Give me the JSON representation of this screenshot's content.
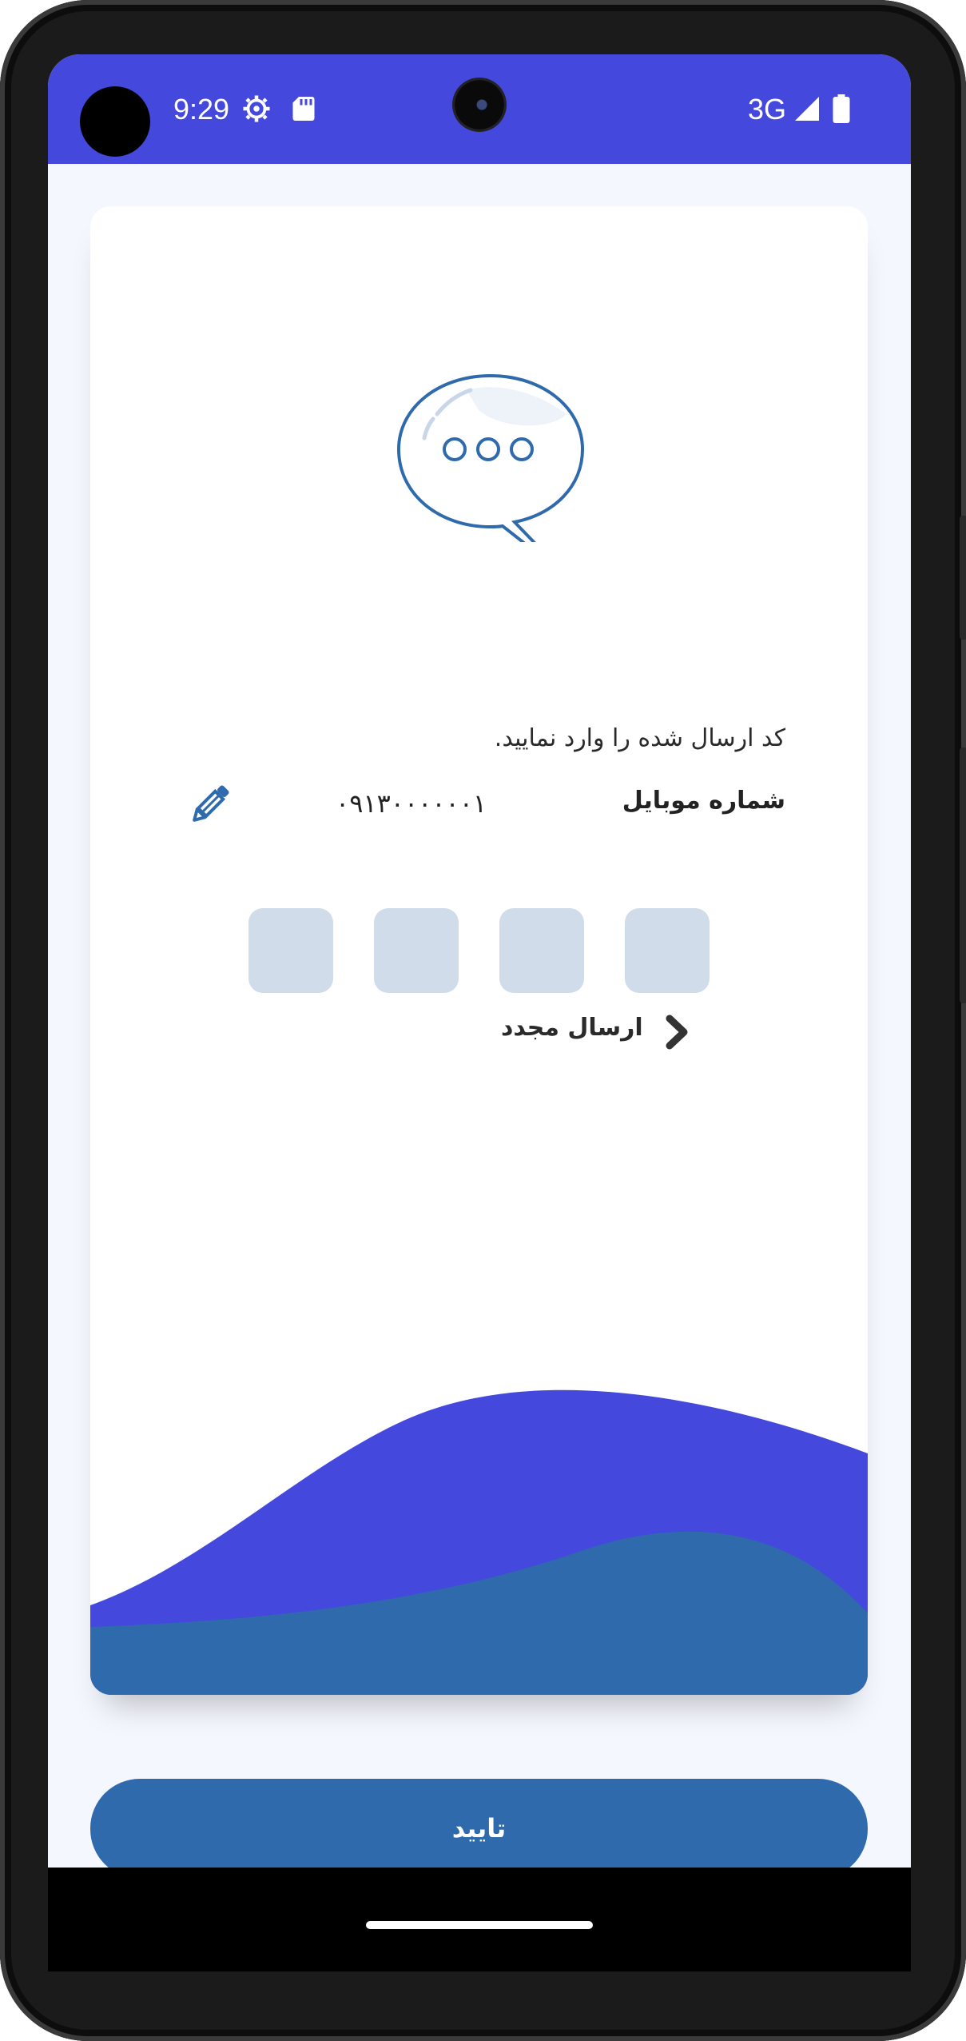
{
  "status_bar": {
    "time": "9:29",
    "network": "3G",
    "icons": [
      "settings-gear-icon",
      "sd-card-icon",
      "signal-icon",
      "battery-icon"
    ],
    "background": "#4548dd"
  },
  "verify": {
    "instruction": "کد ارسال شده را وارد نمایید.",
    "phone_label": "شماره موبایل",
    "phone_number": "۰۹۱۳۰۰۰۰۰۰۱",
    "otp_count": 4,
    "resend_label": "ارسال مجدد",
    "confirm_label": "تایید"
  },
  "colors": {
    "accent_blue": "#2f6aad",
    "wave_purple": "#4548dd",
    "otp_box": "#d0dcea",
    "background": "#f4f7fe"
  }
}
